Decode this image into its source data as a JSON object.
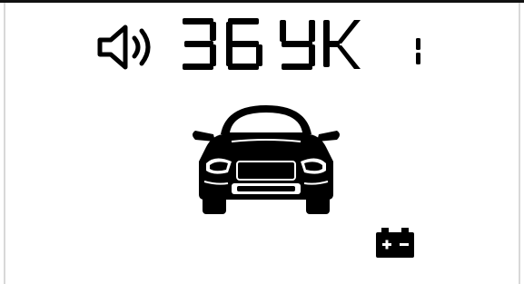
{
  "display": {
    "volume_value": "36",
    "mode_code": "YK",
    "channel_indicator": "1"
  },
  "icons": {
    "volume": "speaker-icon",
    "vehicle": "car-front-icon",
    "battery": "battery-icon"
  },
  "colors": {
    "background": "#ffffff",
    "segment_on": "#000000"
  }
}
